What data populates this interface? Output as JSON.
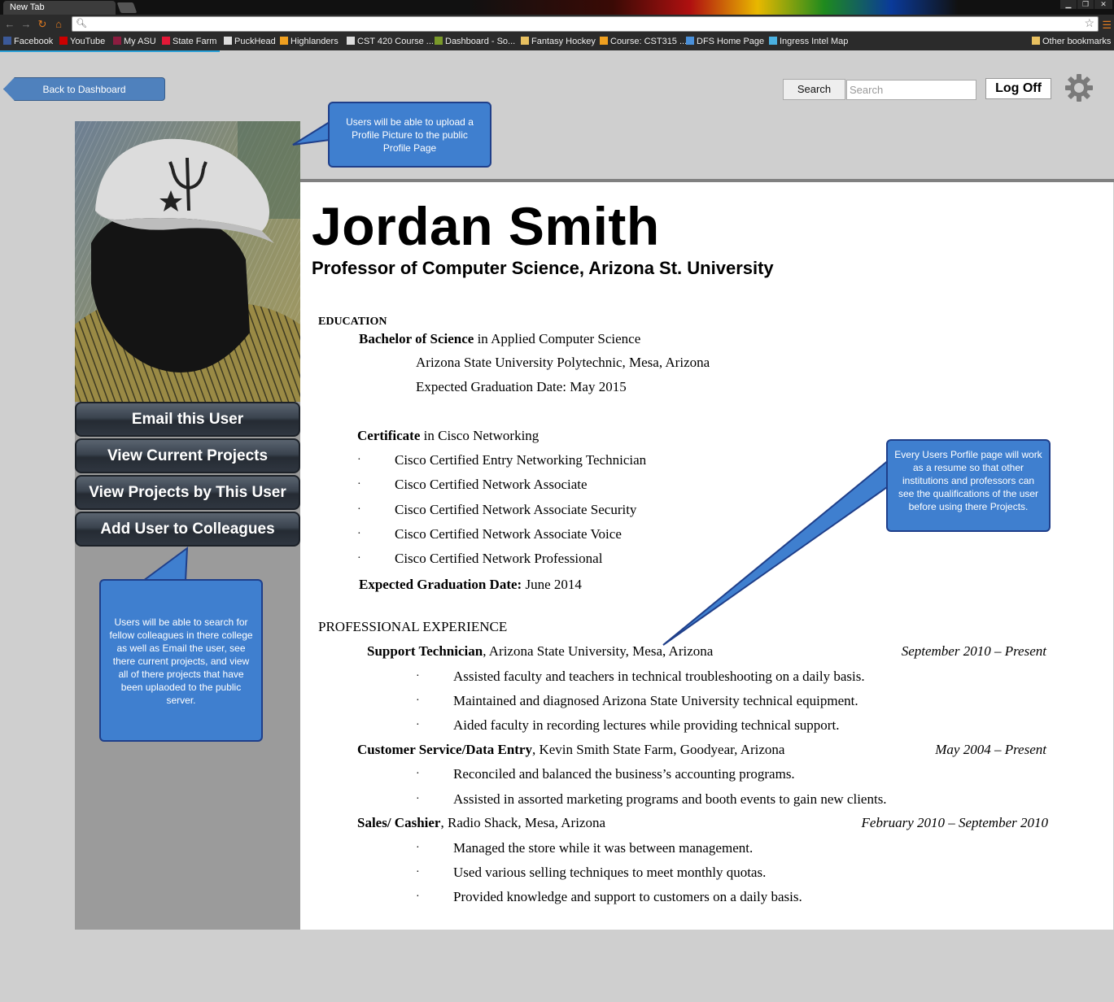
{
  "browser": {
    "tab_title": "New Tab",
    "bookmarks": [
      {
        "label": "Facebook",
        "color": "#3b5998"
      },
      {
        "label": "YouTube",
        "color": "#cc0000"
      },
      {
        "label": "My ASU",
        "color": "#8c1d40"
      },
      {
        "label": "State Farm",
        "color": "#e31837"
      },
      {
        "label": "PuckHead",
        "color": "#dddddd"
      },
      {
        "label": "Highlanders",
        "color": "#f0a020"
      },
      {
        "label": "CST 420 Course ...",
        "color": "#dddddd"
      },
      {
        "label": "Dashboard - So...",
        "color": "#7a9a2a"
      },
      {
        "label": "Fantasy Hockey",
        "color": "#e8c060"
      },
      {
        "label": "Course: CST315 ...",
        "color": "#f0a020"
      },
      {
        "label": "DFS Home Page",
        "color": "#4a90d9"
      },
      {
        "label": "Ingress Intel Map",
        "color": "#4ab0e0"
      }
    ],
    "other_bookmarks": "Other bookmarks"
  },
  "header": {
    "back_label": "Back to Dashboard",
    "search_button": "Search",
    "search_placeholder": "Search",
    "logoff_label": "Log Off"
  },
  "sidebar": {
    "buttons": [
      "Email this User",
      "View Current Projects",
      "View Projects by This User",
      "Add User to Colleagues"
    ]
  },
  "callouts": {
    "photo": "Users will be able to upload a Profile Picture to the public Profile Page",
    "resume": "Every Users Porfile page will work as a resume so that other institutions and professors can see the qualifications of the user before using there Projects.",
    "search": "Users will be able to search for fellow colleagues in there college as well as Email the user, see there current projects, and view all of there projects that have been uplaoded to the public server."
  },
  "profile": {
    "name": "Jordan Smith",
    "title": "Professor of Computer Science, Arizona St. University"
  },
  "education": {
    "heading": "EDUCATION",
    "degree_bold": "Bachelor of Science",
    "degree_rest": " in Applied Computer Science",
    "school": "Arizona State University Polytechnic, Mesa, Arizona",
    "grad": "Expected Graduation Date: May 2015",
    "cert_bold": "Certificate",
    "cert_rest": " in Cisco Networking",
    "certs": [
      "Cisco Certified Entry Networking Technician",
      "Cisco Certified Network Associate",
      "Cisco Certified Network Associate Security",
      "Cisco Certified Network Associate Voice",
      "Cisco Certified Network Professional"
    ],
    "cert_grad_bold": "Expected Graduation Date:",
    "cert_grad_rest": " June 2014",
    "bullet": "·"
  },
  "experience": {
    "heading": "PROFESSIONAL EXPERIENCE",
    "jobs": [
      {
        "title": "Support Technician",
        "org": ", Arizona State University, Mesa, Arizona",
        "dates": "September 2010 – Present",
        "items": [
          "Assisted faculty and teachers in technical troubleshooting on a daily basis.",
          "Maintained and diagnosed Arizona State University technical equipment.",
          "Aided faculty in recording lectures while providing technical support."
        ]
      },
      {
        "title": "Customer Service/Data Entry",
        "org": ", Kevin Smith State Farm, Goodyear, Arizona",
        "dates": "May 2004 – Present",
        "items": [
          "Reconciled and balanced the business’s accounting programs.",
          "Assisted in assorted marketing programs and booth events to gain new clients."
        ]
      },
      {
        "title": "Sales/ Cashier",
        "org": ", Radio Shack, Mesa, Arizona",
        "dates": "February 2010 – September 2010",
        "items": [
          "Managed the store while it was between management.",
          "Used various selling techniques to meet monthly quotas.",
          "Provided knowledge and support to customers on a daily basis."
        ]
      }
    ]
  }
}
